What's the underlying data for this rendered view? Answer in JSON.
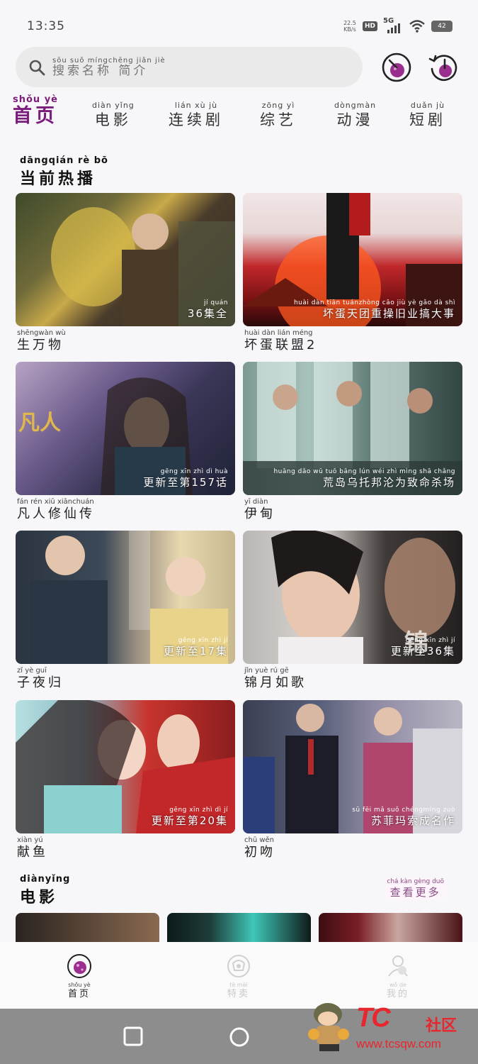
{
  "status": {
    "time": "13:35",
    "speed_top": "22.5",
    "speed_unit": "KB/s",
    "hd": "HD",
    "network": "5G",
    "battery": "42"
  },
  "search": {
    "placeholder_py": "sōu suǒ míngchēng jiǎn jiè",
    "placeholder": "搜索名称 简介"
  },
  "tabs": [
    {
      "py": "shǒu yè",
      "label": "首页",
      "active": true
    },
    {
      "py": "diàn yǐng",
      "label": "电影"
    },
    {
      "py": "lián xù jù",
      "label": "连续剧"
    },
    {
      "py": "zōng yì",
      "label": "综艺"
    },
    {
      "py": "dòngmàn",
      "label": "动漫"
    },
    {
      "py": "duǎn jù",
      "label": "短剧"
    }
  ],
  "section_now": {
    "py": "dāngqián rè bō",
    "title": "当前热播"
  },
  "cards": [
    {
      "badge_py": "jí quán",
      "badge": "36集全",
      "title_py": "shēngwàn wù",
      "title": "生万物"
    },
    {
      "badge_py": "huài dàn tiān tuánzhòng cāo jiù yè gǎo dà shì",
      "badge": "坏蛋天团重操旧业搞大事",
      "title_py": "huài dàn lián méng",
      "title": "坏蛋联盟2"
    },
    {
      "badge_py": "gēng xīn zhì dì huà",
      "badge": "更新至第157话",
      "title_py": "fán rén xiū xiānchuán",
      "title": "凡人修仙传"
    },
    {
      "badge_py": "huāng dǎo wū tuō bāng lún wéi zhì mìng shā chǎng",
      "badge": "荒岛乌托邦沦为致命杀场",
      "title_py": "yī diàn",
      "title": "伊甸"
    },
    {
      "badge_py": "gēng xīn zhì jí",
      "badge": "更新至17集",
      "title_py": "zǐ yè guī",
      "title": "子夜归"
    },
    {
      "badge_py": "gēng xīn zhì jí",
      "badge": "更新至36集",
      "title_py": "jǐn yuè rú gē",
      "title": "锦月如歌"
    },
    {
      "badge_py": "gēng xīn zhì dì jí",
      "badge": "更新至第20集",
      "title_py": "xiàn yú",
      "title": "献鱼"
    },
    {
      "badge_py": "sū fēi mǎ suǒ chéngmíng zuò",
      "badge": "苏菲玛索成名作",
      "title_py": "chū wěn",
      "title": "初吻"
    }
  ],
  "section_movie": {
    "py": "diànyǐng",
    "title": "电影",
    "more_py": "chá kàn gèng duō",
    "more": "查看更多"
  },
  "bottom_nav": [
    {
      "py": "shǒu yè",
      "label": "首页",
      "icon": "home-planet-icon"
    },
    {
      "py": "tè mài",
      "label": "特卖",
      "icon": "sale-icon"
    },
    {
      "py": "wǒ de",
      "label": "我的",
      "icon": "profile-icon"
    }
  ],
  "watermark": {
    "logo": "TC",
    "text": "社区",
    "url": "www.tcsqw.com"
  },
  "colors": {
    "accent": "#7a1c7c",
    "icon_fill": "#9b2f8f"
  }
}
